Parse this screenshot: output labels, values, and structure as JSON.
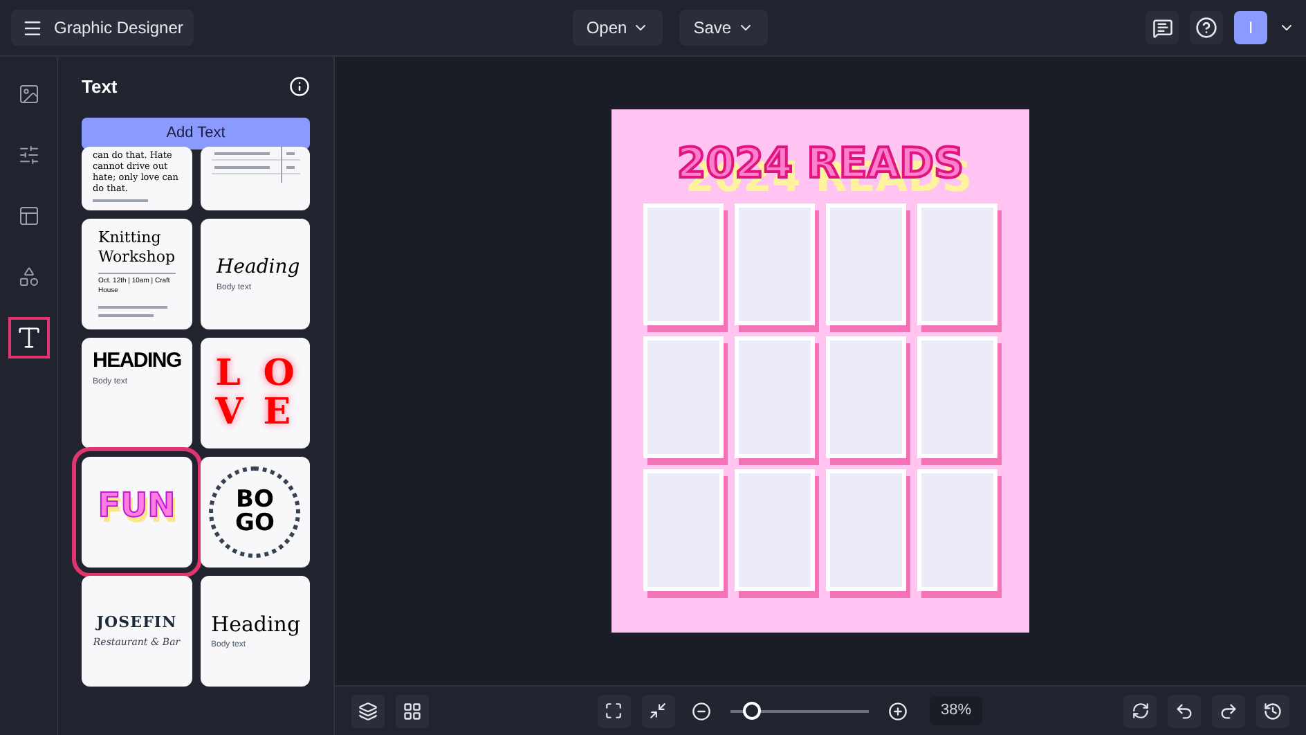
{
  "app": {
    "title": "Graphic Designer"
  },
  "menus": [
    {
      "label": "Open"
    },
    {
      "label": "Save"
    }
  ],
  "user": {
    "initial": "I"
  },
  "rail": [
    {
      "kind": "image",
      "selected": false
    },
    {
      "kind": "adjust",
      "selected": false
    },
    {
      "kind": "layout",
      "selected": false
    },
    {
      "kind": "shapes",
      "selected": false
    },
    {
      "kind": "text",
      "selected": true
    }
  ],
  "panel": {
    "title": "Text",
    "add_button": "Add Text"
  },
  "templates": [
    {
      "kind": "quote",
      "selected": false,
      "lines": [
        "can do that. Hate cannot drive out hate; only love can do that."
      ]
    },
    {
      "kind": "menu",
      "selected": false
    },
    {
      "kind": "knitting",
      "selected": false,
      "lines": [
        "Knitting Workshop",
        "Oct. 12th | 10am | Craft House"
      ]
    },
    {
      "kind": "script",
      "selected": false,
      "lines": [
        "Heading",
        "Body text"
      ]
    },
    {
      "kind": "bold",
      "selected": false,
      "lines": [
        "HEADING",
        "Body text"
      ]
    },
    {
      "kind": "love",
      "selected": false,
      "lines": [
        "L",
        "O",
        "V",
        "E"
      ]
    },
    {
      "kind": "fun",
      "selected": true,
      "lines": [
        "FUN"
      ]
    },
    {
      "kind": "bogo",
      "selected": false,
      "lines": [
        "BO",
        "GO"
      ]
    },
    {
      "kind": "josefin",
      "selected": false,
      "lines": [
        "JOSEFIN",
        "Restaurant & Bar"
      ]
    },
    {
      "kind": "serif",
      "selected": false,
      "lines": [
        "Heading",
        "Body text"
      ]
    }
  ],
  "canvas": {
    "heading": "2024 READS"
  },
  "zoom": {
    "level": 0.15,
    "reading": "38%"
  }
}
